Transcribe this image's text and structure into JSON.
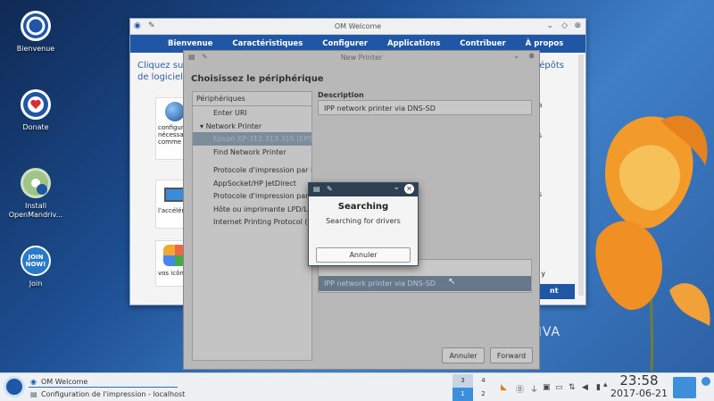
{
  "desktop": {
    "icons": [
      {
        "label": "Bienvenue"
      },
      {
        "label": "Donate"
      },
      {
        "label": "Install\nOpenMandriv..."
      },
      {
        "label": "Join"
      }
    ],
    "join_badge": "JOIN\nNOW!",
    "brand_partial": "RIVA"
  },
  "welcome_window": {
    "title": "OM Welcome",
    "menu": [
      "Bienvenue",
      "Caractéristiques",
      "Configurer",
      "Applications",
      "Contribuer",
      "À propos"
    ],
    "intro_left": "Cliquez sur\nde logiciels,",
    "intro_right": "épôts",
    "card_texts": [
      "configura\nnécessai\ncomme :",
      "l'accélér",
      "vos icône"
    ],
    "right_fragments": [
      "va",
      "es",
      "es",
      "el, y",
      "nt"
    ]
  },
  "new_printer": {
    "title": "New Printer",
    "heading": "Choisissez le périphérique",
    "tree_header": "Périphériques",
    "tree_items": [
      {
        "label": "Enter URI",
        "kind": "item"
      },
      {
        "label": "Network Printer",
        "kind": "group"
      },
      {
        "label": "Epson XP-312 313 315 (EPSON",
        "kind": "selected"
      },
      {
        "label": "Find Network Printer",
        "kind": "item"
      },
      {
        "label": "Protocole d'impression par Int",
        "kind": "gap"
      },
      {
        "label": "AppSocket/HP JetDirect",
        "kind": "item"
      },
      {
        "label": "Protocole d'impression par I",
        "kind": "item"
      },
      {
        "label": "Hôte ou imprimante LPD/LPR",
        "kind": "item"
      },
      {
        "label": "Internet Printing Protocol (ipp",
        "kind": "item"
      }
    ],
    "description_label": "Description",
    "description_value": "IPP network printer via DNS-SD",
    "connection_selected": "IPP network printer via DNS-SD",
    "cancel_label": "Annuler",
    "forward_label": "Forward"
  },
  "search_dialog": {
    "title": "Searching",
    "message": "Searching for drivers",
    "cancel_label": "Annuler"
  },
  "taskbar": {
    "tasks": [
      "OM Welcome",
      "Configuration de l'impression - localhost"
    ],
    "pager": [
      "3",
      "4",
      "1",
      "2"
    ],
    "time": "23:58",
    "date": "2017-06-21"
  }
}
